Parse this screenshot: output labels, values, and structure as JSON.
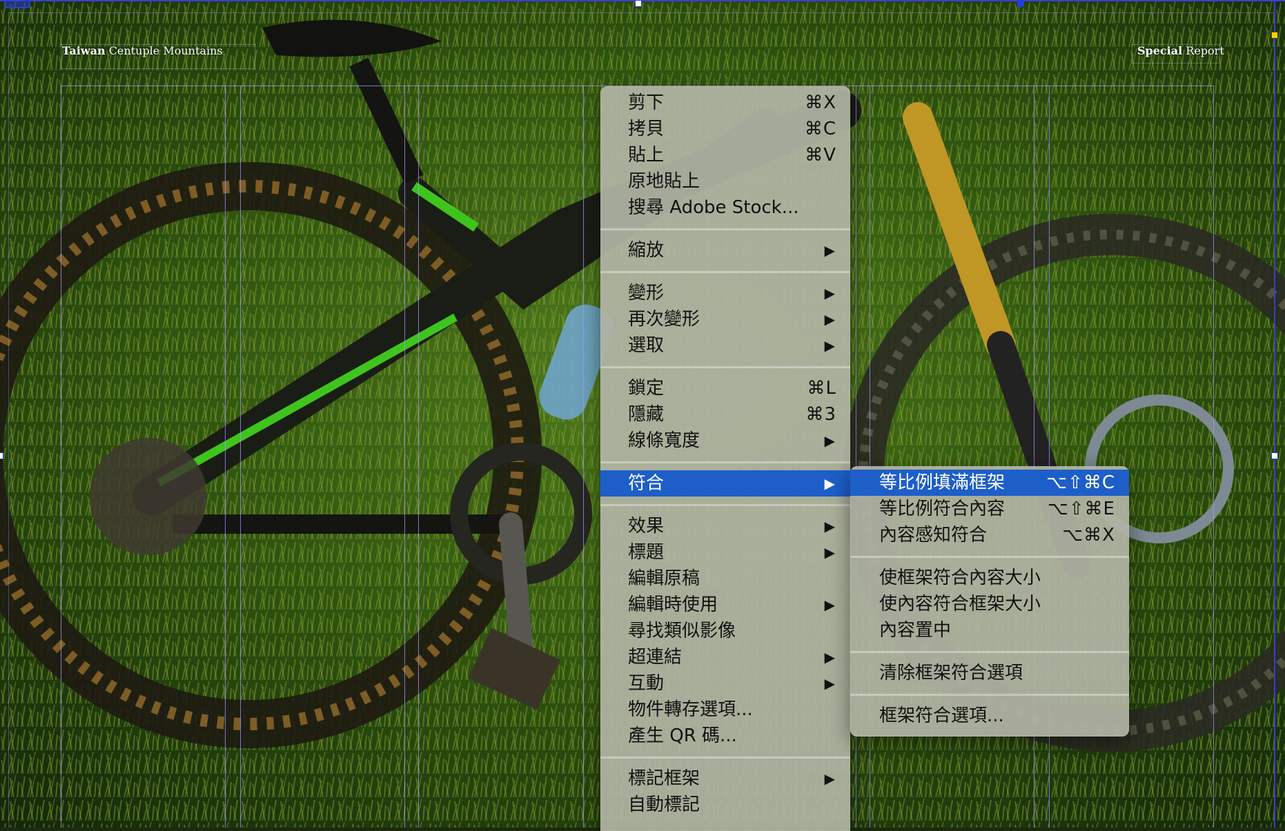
{
  "page": {
    "header_left_bold": "Taiwan",
    "header_left_rest": "Centuple Mountains",
    "header_right_bold": "Special",
    "header_right_rest": "Report"
  },
  "context_menu": {
    "items": [
      {
        "label": "剪下",
        "shortcut": "⌘X"
      },
      {
        "label": "拷貝",
        "shortcut": "⌘C"
      },
      {
        "label": "貼上",
        "shortcut": "⌘V"
      },
      {
        "label": "原地貼上",
        "shortcut": ""
      },
      {
        "label": "搜尋 Adobe Stock...",
        "shortcut": ""
      },
      {
        "label": "縮放",
        "submenu": "▶"
      },
      {
        "label": "變形",
        "submenu": "▶"
      },
      {
        "label": "再次變形",
        "submenu": "▶"
      },
      {
        "label": "選取",
        "submenu": "▶"
      },
      {
        "label": "鎖定",
        "shortcut": "⌘L"
      },
      {
        "label": "隱藏",
        "shortcut": "⌘3"
      },
      {
        "label": "線條寬度",
        "submenu": "▶"
      },
      {
        "label": "符合",
        "submenu": "▶",
        "highlighted": true
      },
      {
        "label": "效果",
        "submenu": "▶"
      },
      {
        "label": "標題",
        "submenu": "▶"
      },
      {
        "label": "編輯原稿",
        "shortcut": ""
      },
      {
        "label": "編輯時使用",
        "submenu": "▶"
      },
      {
        "label": "尋找類似影像",
        "shortcut": ""
      },
      {
        "label": "超連結",
        "submenu": "▶"
      },
      {
        "label": "互動",
        "submenu": "▶"
      },
      {
        "label": "物件轉存選項...",
        "shortcut": ""
      },
      {
        "label": "產生 QR 碼...",
        "shortcut": ""
      },
      {
        "label": "標記框架",
        "submenu": "▶"
      },
      {
        "label": "自動標記",
        "shortcut": ""
      }
    ]
  },
  "fit_submenu": {
    "items": [
      {
        "label": "等比例填滿框架",
        "shortcut": "⌥⇧⌘C",
        "highlighted": true
      },
      {
        "label": "等比例符合內容",
        "shortcut": "⌥⇧⌘E"
      },
      {
        "label": "內容感知符合",
        "shortcut": "⌥⌘X"
      },
      {
        "label": "使框架符合內容大小",
        "shortcut": ""
      },
      {
        "label": "使內容符合框架大小",
        "shortcut": ""
      },
      {
        "label": "內容置中",
        "shortcut": ""
      },
      {
        "label": "清除框架符合選項",
        "shortcut": ""
      },
      {
        "label": "框架符合選項...",
        "shortcut": ""
      }
    ]
  },
  "colors": {
    "highlight": "#1d5ec9",
    "menu_bg": "#b0b4a4",
    "guide": "#aa96ff"
  }
}
